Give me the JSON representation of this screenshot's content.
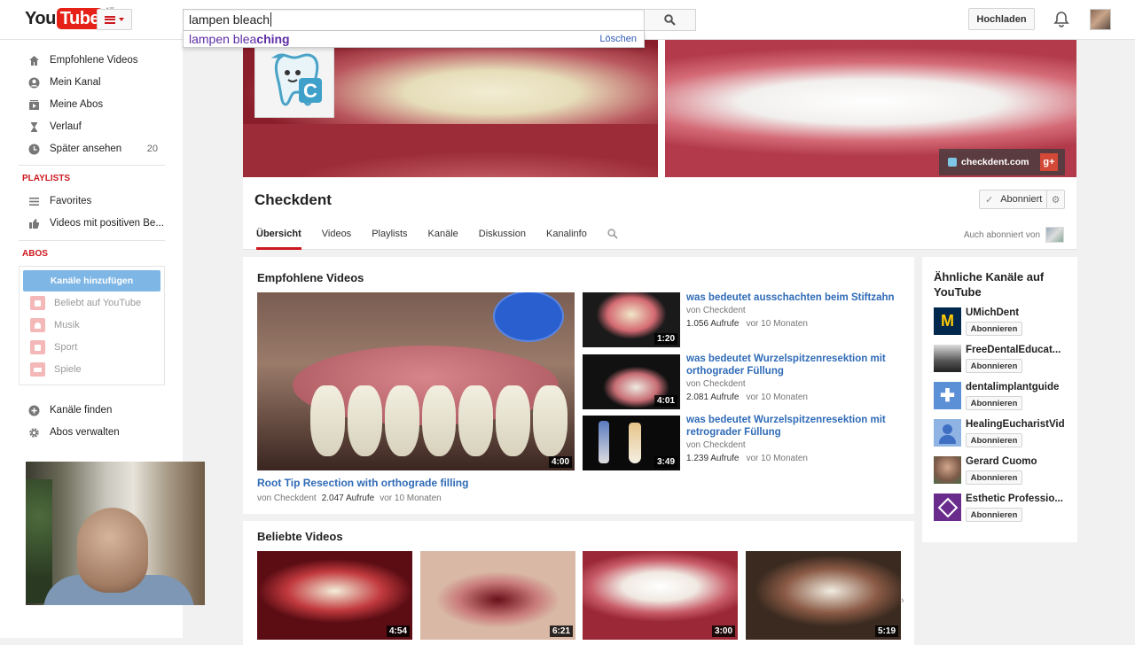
{
  "header": {
    "logo_you": "You",
    "logo_tube": "Tube",
    "logo_region": "AT",
    "search_value": "lampen bleach",
    "suggestion_prefix": "lampen blea",
    "suggestion_suffix": "ching",
    "suggestion_delete": "Löschen",
    "upload_label": "Hochladen"
  },
  "sidebar": {
    "items": [
      {
        "label": "Empfohlene Videos",
        "icon": "home-icon"
      },
      {
        "label": "Mein Kanal",
        "icon": "person-icon"
      },
      {
        "label": "Meine Abos",
        "icon": "subscriptions-icon"
      },
      {
        "label": "Verlauf",
        "icon": "hourglass-icon"
      },
      {
        "label": "Später ansehen",
        "icon": "clock-icon",
        "count": "20"
      }
    ],
    "playlists_heading": "PLAYLISTS",
    "playlists": [
      {
        "label": "Favorites",
        "icon": "list-icon"
      },
      {
        "label": "Videos mit positiven Be...",
        "icon": "thumbs-up-icon"
      }
    ],
    "abos_heading": "ABOS",
    "add_channels": "Kanäle hinzufügen",
    "subs": [
      {
        "label": "Beliebt auf YouTube"
      },
      {
        "label": "Musik"
      },
      {
        "label": "Sport"
      },
      {
        "label": "Spiele"
      }
    ],
    "bottom": [
      {
        "label": "Kanäle finden",
        "icon": "plus-circle-icon"
      },
      {
        "label": "Abos verwalten",
        "icon": "gear-icon"
      }
    ]
  },
  "channel": {
    "name": "Checkdent",
    "banner_site": "checkdent.com",
    "gplus": "g+",
    "subscribed_label": "Abonniert",
    "tabs": [
      "Übersicht",
      "Videos",
      "Playlists",
      "Kanäle",
      "Diskussion",
      "Kanalinfo"
    ],
    "also_subscribed": "Auch abonniert von"
  },
  "featured": {
    "heading": "Empfohlene Videos",
    "main": {
      "title": "Root Tip Resection with orthograde filling",
      "by": "von Checkdent",
      "views": "2.047 Aufrufe",
      "age": "vor 10 Monaten",
      "duration": "4:00"
    },
    "side": [
      {
        "title": "was bedeutet ausschachten beim Stiftzahn",
        "by": "von Checkdent",
        "views": "1.056 Aufrufe",
        "age": "vor 10 Monaten",
        "duration": "1:20"
      },
      {
        "title": "was bedeutet Wurzelspitzenresektion mit orthograder Füllung",
        "by": "von Checkdent",
        "views": "2.081 Aufrufe",
        "age": "vor 10 Monaten",
        "duration": "4:01"
      },
      {
        "title": "was bedeutet Wurzelspitzenresektion mit retrograder Füllung",
        "by": "von Checkdent",
        "views": "1.239 Aufrufe",
        "age": "vor 10 Monaten",
        "duration": "3:49"
      }
    ]
  },
  "popular": {
    "heading": "Beliebte Videos",
    "videos": [
      {
        "duration": "4:54"
      },
      {
        "duration": "6:21"
      },
      {
        "duration": "3:00"
      },
      {
        "duration": "5:19"
      }
    ]
  },
  "similar": {
    "heading": "Ähnliche Kanäle auf YouTube",
    "subscribe_label": "Abonnieren",
    "channels": [
      {
        "name": "UMichDent"
      },
      {
        "name": "FreeDentalEducat..."
      },
      {
        "name": "dentalimplantguide"
      },
      {
        "name": "HealingEucharistVid"
      },
      {
        "name": "Gerard Cuomo"
      },
      {
        "name": "Esthetic Professio..."
      }
    ]
  },
  "colors": {
    "brand_red": "#e62117",
    "link_blue": "#2f6bb7",
    "section_red": "#cc181e"
  }
}
